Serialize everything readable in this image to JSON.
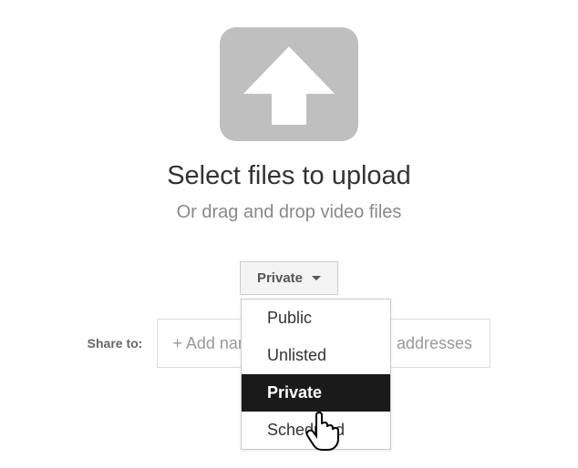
{
  "upload": {
    "title": "Select files to upload",
    "subtitle": "Or drag and drop video files"
  },
  "privacy": {
    "selected": "Private",
    "options": {
      "public": "Public",
      "unlisted": "Unlisted",
      "private": "Private",
      "scheduled": "Scheduled"
    }
  },
  "share": {
    "label": "Share to:",
    "placeholder": "+ Add names, circles, or email addresses"
  }
}
